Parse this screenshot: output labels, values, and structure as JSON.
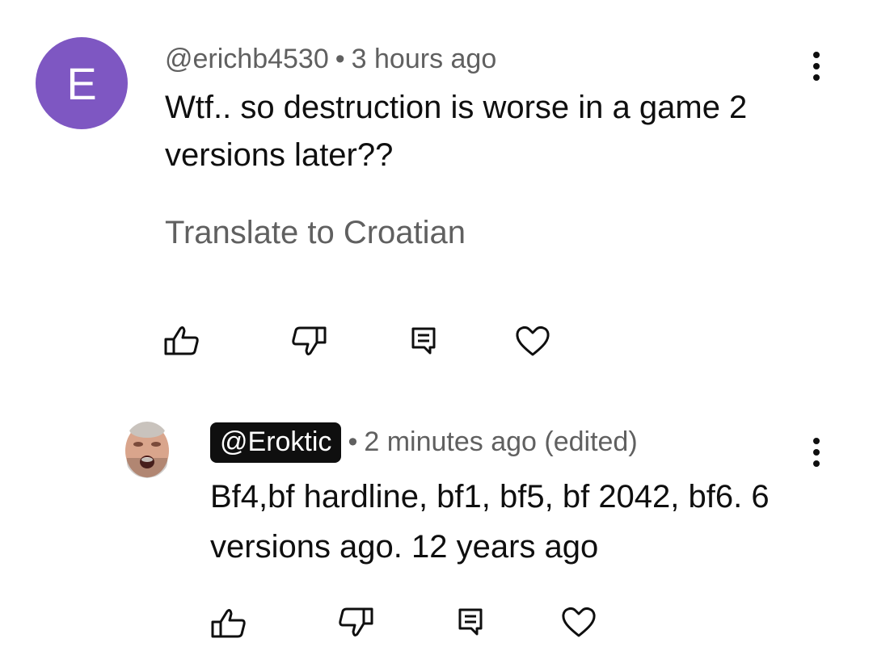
{
  "comment": {
    "avatar_letter": "E",
    "author": "@erichb4530",
    "separator": "•",
    "time": "3 hours ago",
    "text_line1": "Wtf.. so destruction is worse in a game 2",
    "text_line2": "versions later??",
    "translate": "Translate to Croatian",
    "avatar_color": "#7e57c2"
  },
  "reply": {
    "author": "@Eroktic",
    "separator": "•",
    "time": "2 minutes ago (edited)",
    "text_line1": "Bf4,bf hardline, bf1, bf5, bf 2042, bf6. 6",
    "text_line2": "versions ago. 12 years ago"
  },
  "icons": {
    "like": "thumbs-up-icon",
    "dislike": "thumbs-down-icon",
    "reply": "reply-comment-icon",
    "heart": "heart-icon",
    "more": "more-vertical-icon"
  }
}
